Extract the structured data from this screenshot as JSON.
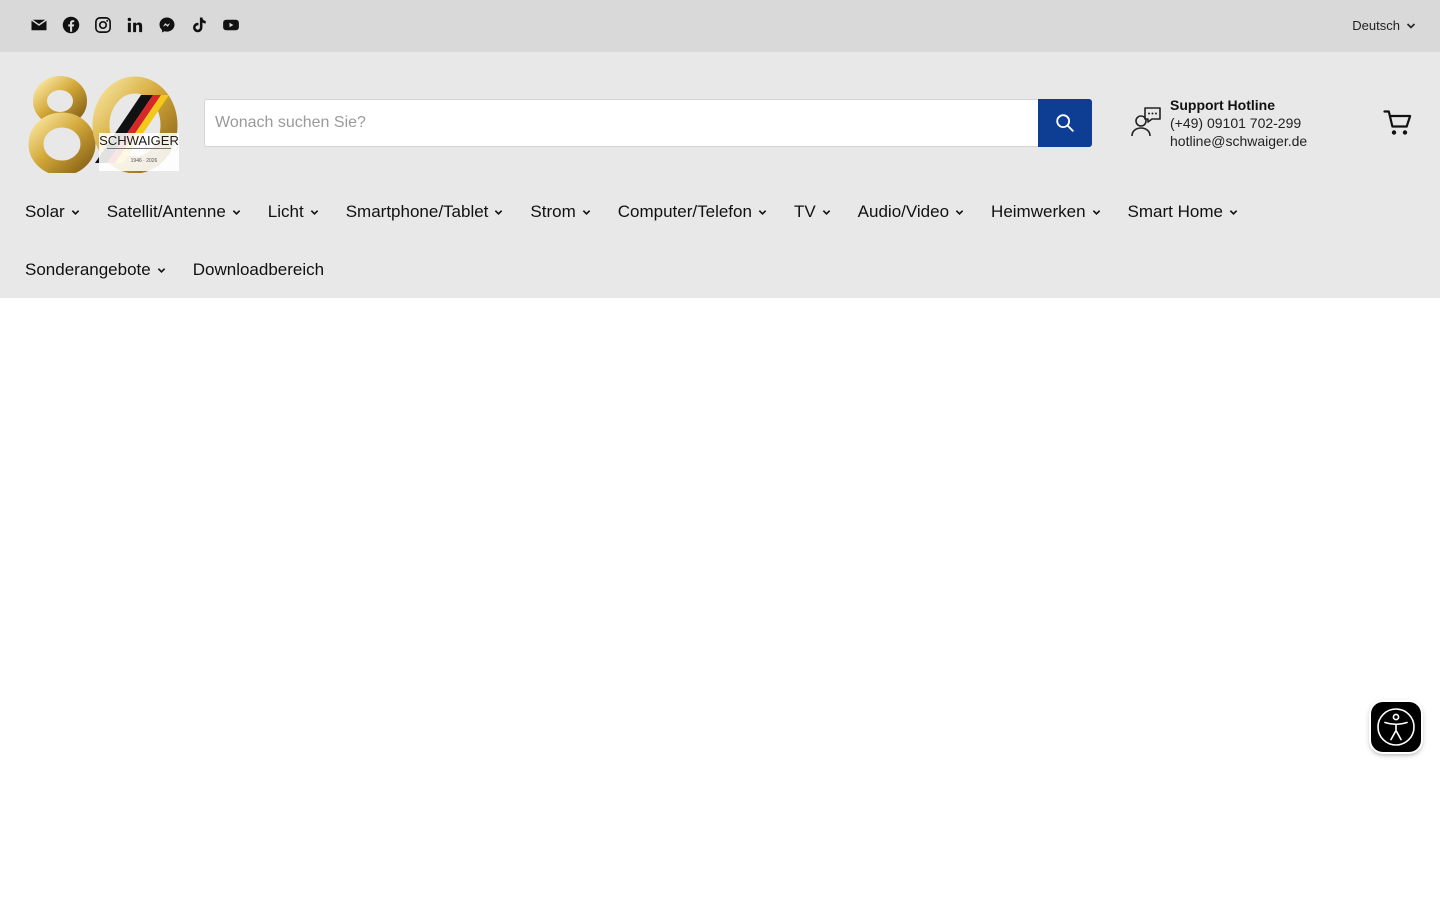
{
  "topbar": {
    "social_icons": [
      "email-icon",
      "facebook-icon",
      "instagram-icon",
      "linkedin-icon",
      "messenger-icon",
      "tiktok-icon",
      "youtube-icon"
    ],
    "language_label": "Deutsch"
  },
  "header": {
    "logo": {
      "big_number": "80",
      "brand": "SCHWAIGER",
      "years": "1946 - 2026"
    },
    "search": {
      "placeholder": "Wonach suchen Sie?"
    },
    "support": {
      "title": "Support Hotline",
      "phone": "(+49) 09101 702-299",
      "email": "hotline@schwaiger.de"
    }
  },
  "nav": {
    "row1": [
      {
        "label": "Solar",
        "dropdown": true
      },
      {
        "label": "Satellit/Antenne",
        "dropdown": true
      },
      {
        "label": "Licht",
        "dropdown": true
      },
      {
        "label": "Smartphone/Tablet",
        "dropdown": true
      },
      {
        "label": "Strom",
        "dropdown": true
      },
      {
        "label": "Computer/Telefon",
        "dropdown": true
      },
      {
        "label": "TV",
        "dropdown": true
      },
      {
        "label": "Audio/Video",
        "dropdown": true
      },
      {
        "label": "Heimwerken",
        "dropdown": true
      },
      {
        "label": "Smart Home",
        "dropdown": true
      }
    ],
    "row2": [
      {
        "label": "Sonderangebote",
        "dropdown": true
      },
      {
        "label": "Downloadbereich",
        "dropdown": false
      }
    ]
  },
  "colors": {
    "topbar_bg": "#d9d9d9",
    "header_bg": "#e8e8e8",
    "search_button": "#0e3d94",
    "logo_gold": "#d4a93a"
  }
}
